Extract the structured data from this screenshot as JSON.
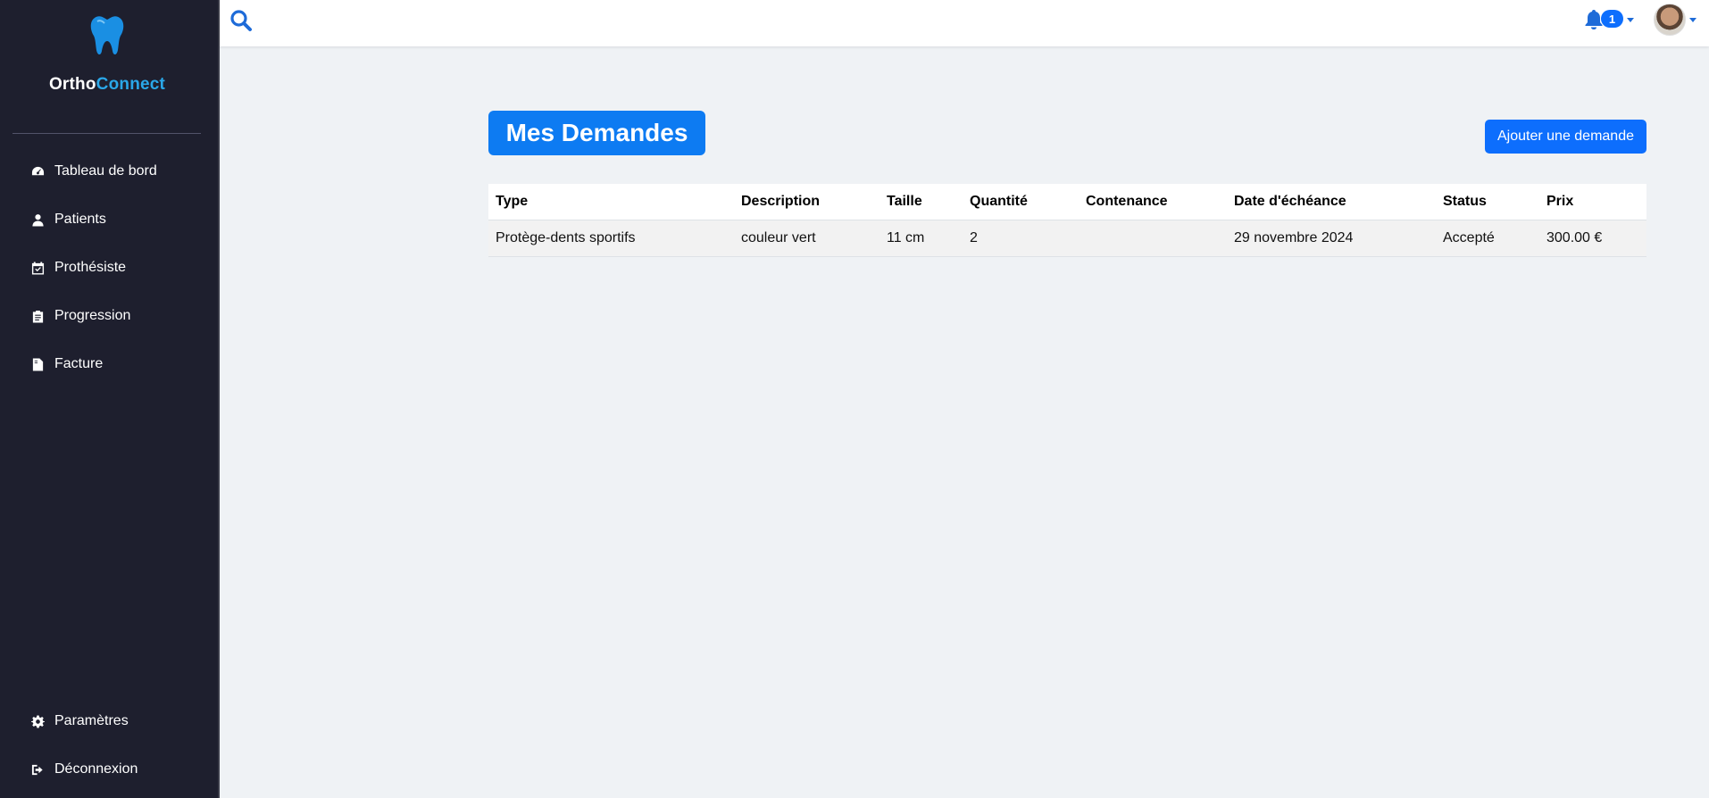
{
  "brand": {
    "part1": "Ortho",
    "part2": "Connect",
    "primary_color": "#ffffff",
    "accent_color": "#2aa7e8"
  },
  "sidebar": {
    "items": [
      {
        "label": "Tableau de bord",
        "icon": "dashboard-gauge-icon"
      },
      {
        "label": "Patients",
        "icon": "user-doctor-icon"
      },
      {
        "label": "Prothésiste",
        "icon": "calendar-check-icon"
      },
      {
        "label": "Progression",
        "icon": "clipboard-list-icon"
      },
      {
        "label": "Facture",
        "icon": "file-invoice-icon"
      }
    ],
    "bottom_items": [
      {
        "label": "Paramètres",
        "icon": "gear-icon"
      },
      {
        "label": "Déconnexion",
        "icon": "sign-out-icon"
      }
    ],
    "background": "#1e1f2e"
  },
  "topbar": {
    "search_icon": "search-icon",
    "notifications": {
      "icon": "bell-icon",
      "count": "1"
    },
    "user": {
      "icon": "avatar"
    }
  },
  "main": {
    "title": "Mes Demandes",
    "add_button_label": "Ajouter une demande",
    "accent": "#0d6efd",
    "table": {
      "headers": [
        "Type",
        "Description",
        "Taille",
        "Quantité",
        "Contenance",
        "Date d'échéance",
        "Status",
        "Prix"
      ],
      "rows": [
        [
          "Protège-dents sportifs",
          "couleur vert",
          "11 cm",
          "2",
          "",
          "29 novembre 2024",
          "Accepté",
          "300.00 €"
        ]
      ]
    }
  }
}
